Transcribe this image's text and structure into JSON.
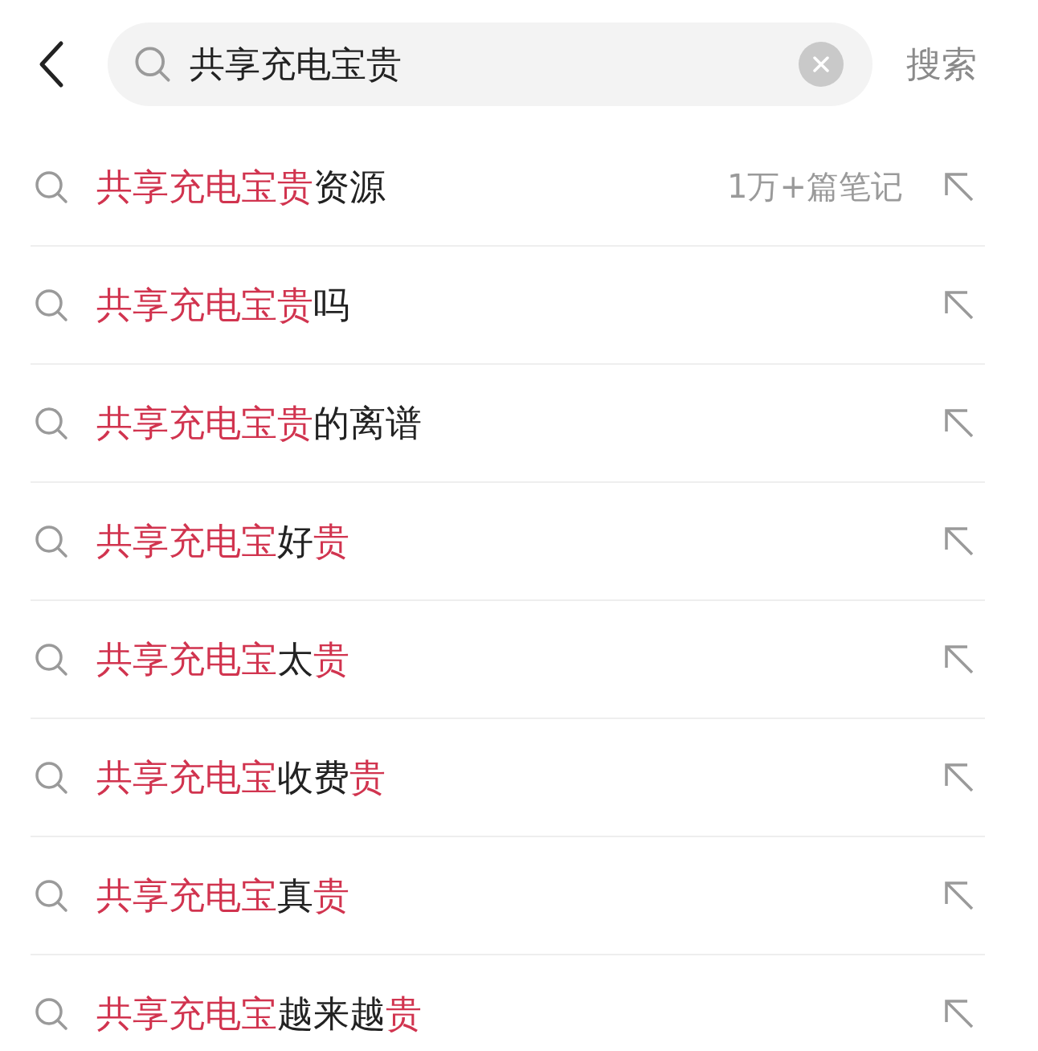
{
  "search": {
    "value": "共享充电宝贵",
    "action": "搜索"
  },
  "suggestions": [
    {
      "segments": [
        {
          "text": "共享充电宝贵",
          "highlight": true
        },
        {
          "text": "资源",
          "highlight": false
        }
      ],
      "count": "1万+篇笔记"
    },
    {
      "segments": [
        {
          "text": "共享充电宝贵",
          "highlight": true
        },
        {
          "text": "吗",
          "highlight": false
        }
      ]
    },
    {
      "segments": [
        {
          "text": "共享充电宝贵",
          "highlight": true
        },
        {
          "text": "的离谱",
          "highlight": false
        }
      ]
    },
    {
      "segments": [
        {
          "text": "共享充电宝",
          "highlight": true
        },
        {
          "text": "好",
          "highlight": false
        },
        {
          "text": "贵",
          "highlight": true
        }
      ]
    },
    {
      "segments": [
        {
          "text": "共享充电宝",
          "highlight": true
        },
        {
          "text": "太",
          "highlight": false
        },
        {
          "text": "贵",
          "highlight": true
        }
      ]
    },
    {
      "segments": [
        {
          "text": "共享充电宝",
          "highlight": true
        },
        {
          "text": "收费",
          "highlight": false
        },
        {
          "text": "贵",
          "highlight": true
        }
      ]
    },
    {
      "segments": [
        {
          "text": "共享充电宝",
          "highlight": true
        },
        {
          "text": "真",
          "highlight": false
        },
        {
          "text": "贵",
          "highlight": true
        }
      ]
    },
    {
      "segments": [
        {
          "text": "共享充电宝",
          "highlight": true
        },
        {
          "text": "越来越",
          "highlight": false
        },
        {
          "text": "贵",
          "highlight": true
        }
      ]
    }
  ]
}
